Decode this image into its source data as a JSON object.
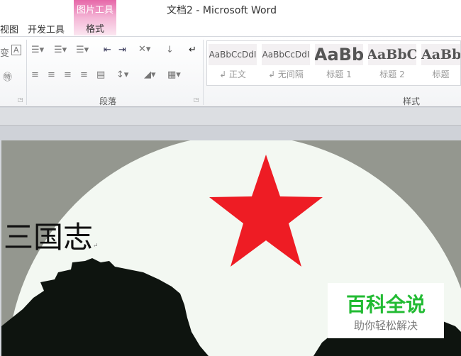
{
  "window": {
    "title": "文档2 - Microsoft Word"
  },
  "tabs": [
    {
      "label": "视图"
    },
    {
      "label": "开发工具"
    }
  ],
  "context_tab": {
    "group": "图片工具",
    "label": "格式"
  },
  "ribbon": {
    "paragraph_group": "段落",
    "styles_group": "样式",
    "styles": [
      {
        "preview": "AaBbCcDdI",
        "name": "↲ 正文"
      },
      {
        "preview": "AaBbCcDdI",
        "name": "↲ 无间隔"
      },
      {
        "preview": "AaBb",
        "name": "标题 1"
      },
      {
        "preview": "AaBbC",
        "name": "标题 2"
      },
      {
        "preview": "AaBb",
        "name": "标题"
      }
    ]
  },
  "document": {
    "text": "三国志",
    "para_mark": "↵"
  },
  "watermark": {
    "main": "百科全说",
    "sub": "助你轻松解决"
  },
  "colors": {
    "accent": "#e667a8",
    "star": "#ee1c24",
    "watermark": "#22bb33"
  }
}
